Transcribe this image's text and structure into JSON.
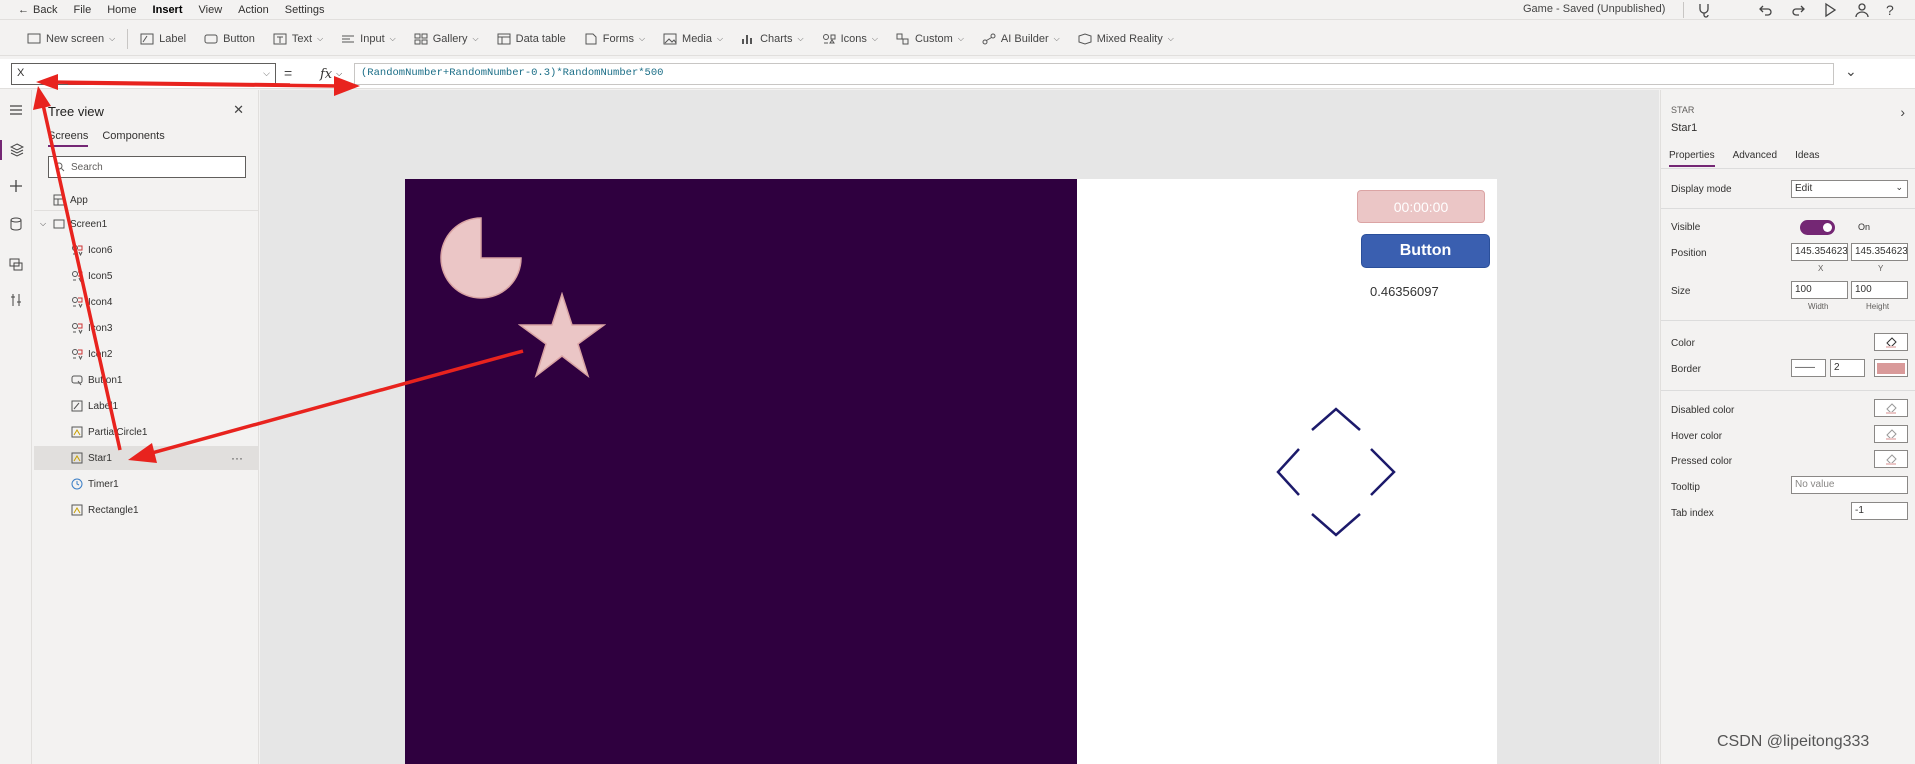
{
  "menu": {
    "back": "Back",
    "items": [
      "File",
      "Home",
      "Insert",
      "View",
      "Action",
      "Settings"
    ],
    "active": "Insert",
    "status": "Game - Saved (Unpublished)"
  },
  "ribbon": {
    "new_screen": "New screen",
    "label": "Label",
    "button": "Button",
    "text": "Text",
    "input": "Input",
    "gallery": "Gallery",
    "data_table": "Data table",
    "forms": "Forms",
    "media": "Media",
    "charts": "Charts",
    "icons": "Icons",
    "custom": "Custom",
    "ai_builder": "AI Builder",
    "mixed_reality": "Mixed Reality"
  },
  "formula": {
    "property": "X",
    "equals": "=",
    "fx": "fx",
    "expression": "(RandomNumber+RandomNumber-0.3)*RandomNumber*500"
  },
  "tree": {
    "title": "Tree view",
    "tabs": [
      "Screens",
      "Components"
    ],
    "search_placeholder": "Search",
    "app": "App",
    "screen": "Screen1",
    "children": [
      "Icon6",
      "Icon5",
      "Icon4",
      "Icon3",
      "Icon2",
      "Button1",
      "Label1",
      "PartialCircle1",
      "Star1",
      "Timer1",
      "Rectangle1"
    ],
    "selected": "Star1",
    "more": "···"
  },
  "canvas": {
    "timer_text": "00:00:00",
    "button_text": "Button",
    "label_text": "0.46356097",
    "colors": {
      "rectangle": "#2f003f",
      "shape_fill": "#ebc6c6",
      "diamond": "#1c1a6b",
      "button": "#3a5fb0"
    }
  },
  "props": {
    "type": "STAR",
    "name": "Star1",
    "tabs": [
      "Properties",
      "Advanced",
      "Ideas"
    ],
    "display_mode_label": "Display mode",
    "display_mode": "Edit",
    "visible_label": "Visible",
    "visible_state": "On",
    "position_label": "Position",
    "pos_x": "145.3546239",
    "pos_y": "145.3546239",
    "x_label": "X",
    "y_label": "Y",
    "size_label": "Size",
    "width": "100",
    "height": "100",
    "width_label": "Width",
    "height_label": "Height",
    "color_label": "Color",
    "border_label": "Border",
    "border_width": "2",
    "disabled_color_label": "Disabled color",
    "hover_color_label": "Hover color",
    "pressed_color_label": "Pressed color",
    "tooltip_label": "Tooltip",
    "tooltip_value": "No value",
    "tab_index_label": "Tab index",
    "tab_index": "-1"
  },
  "watermark": "CSDN @lipeitong333"
}
